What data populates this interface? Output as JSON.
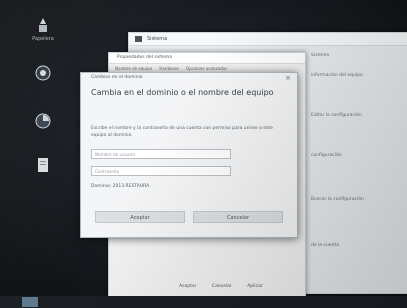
{
  "desktop": {
    "icons": [
      {
        "name": "recycle-bin-icon",
        "label": "Papelera"
      },
      {
        "name": "app-icon",
        "label": ""
      },
      {
        "name": "app-icon-2",
        "label": ""
      },
      {
        "name": "document-icon",
        "label": ""
      }
    ]
  },
  "settings_window": {
    "title": "Sistema",
    "right_items": [
      "Sistema",
      "información del equipo",
      "Editar la configuración",
      "configuración",
      "Buscar la configuración",
      "de la cuenta"
    ]
  },
  "system_props_window": {
    "title": "Propiedades del sistema",
    "tabs": [
      "Nombre de equipo",
      "Hardware",
      "Opciones avanzadas"
    ],
    "footer_buttons": [
      "Aceptar",
      "Cancelar",
      "Aplicar"
    ]
  },
  "dialog": {
    "title": "Cambios en el dominio",
    "heading": "Cambia en el dominio o el nombre del equipo",
    "description": "Escribe el nombre y la contraseña de una cuenta con permiso para unirse a este equipo al dominio.",
    "username_placeholder": "Nombre de usuario",
    "password_placeholder": "Contraseña",
    "domain_label": "Dominio: 2013.RESTAURA.",
    "ok_label": "Aceptar",
    "cancel_label": "Cancelar"
  }
}
